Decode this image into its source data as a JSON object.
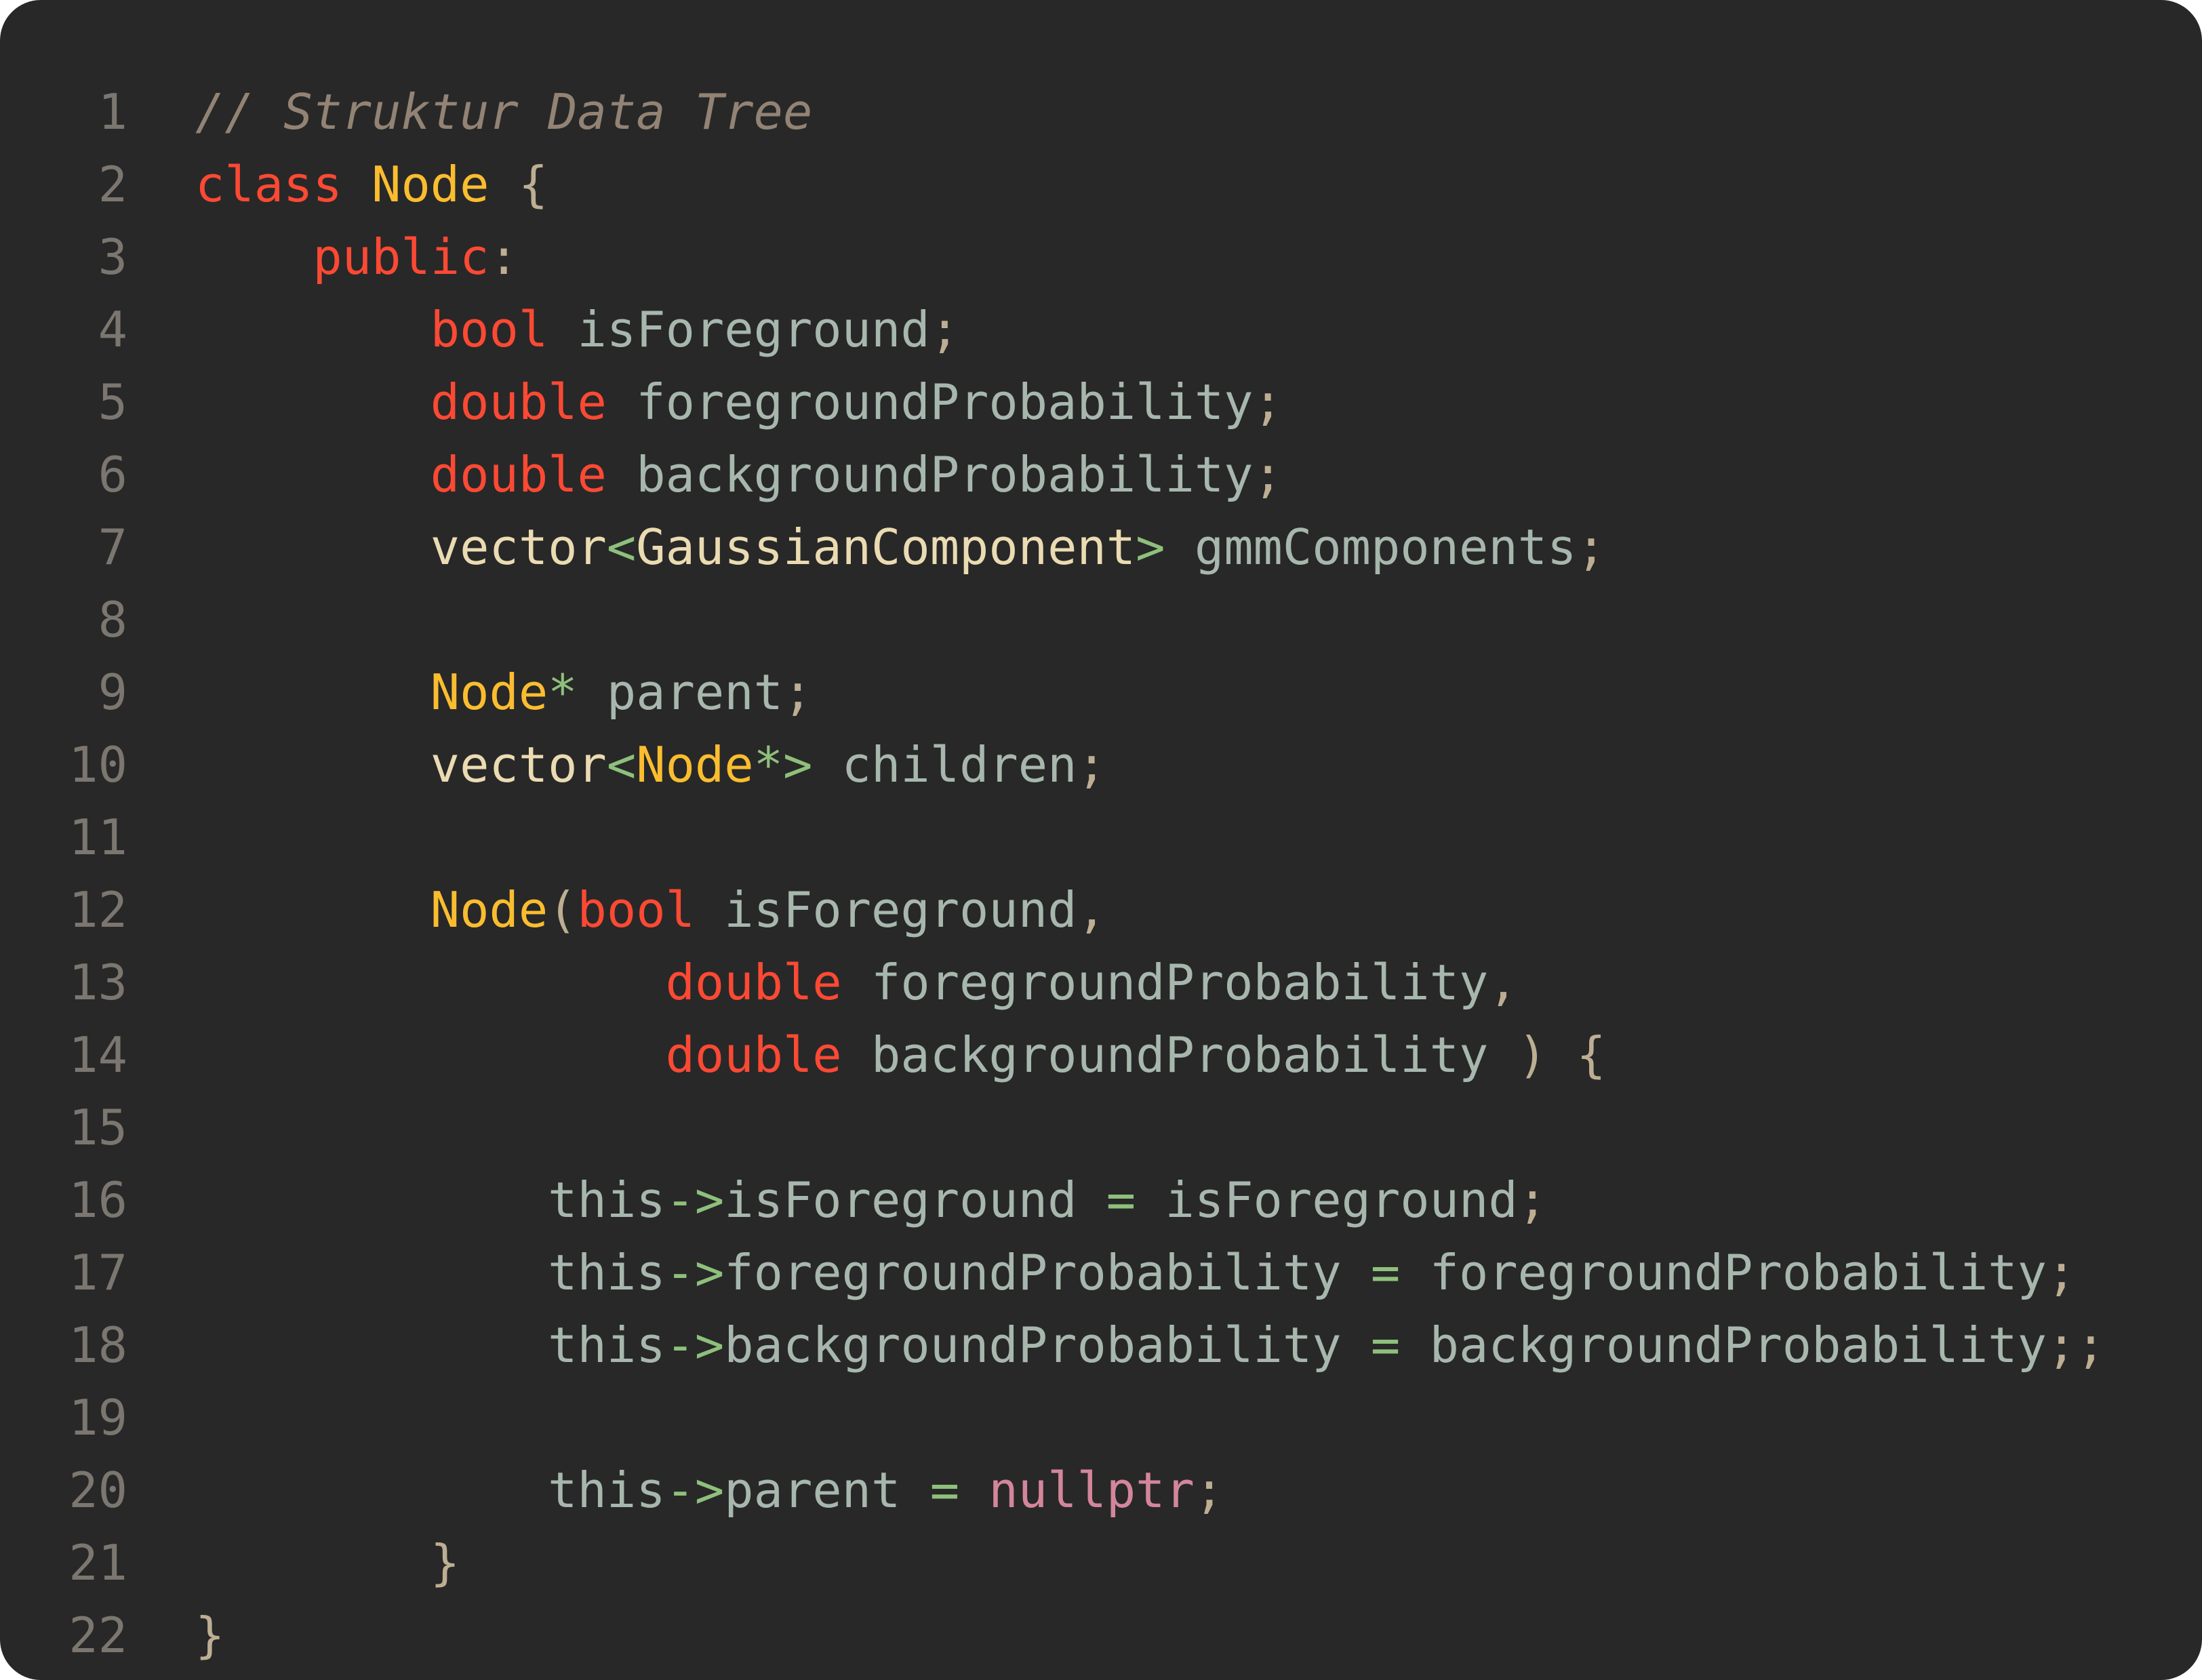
{
  "colors": {
    "background": "#282828",
    "line_number": "#7c7670",
    "comment": "#928374",
    "keyword": "#fb4934",
    "type": "#fabd2f",
    "template": "#ebdbb2",
    "operator": "#8ec07c",
    "punctuation": "#bdae93",
    "identifier": "#a7b7ad",
    "literal": "#d3869b"
  },
  "code": {
    "lines": [
      {
        "number": "1",
        "tokens": [
          {
            "text": "// Struktur Data Tree",
            "kind": "cm"
          }
        ]
      },
      {
        "number": "2",
        "tokens": [
          {
            "text": "class",
            "kind": "kw"
          },
          {
            "text": " ",
            "kind": "id"
          },
          {
            "text": "Node",
            "kind": "ty"
          },
          {
            "text": " {",
            "kind": "pu"
          }
        ]
      },
      {
        "number": "3",
        "tokens": [
          {
            "text": "    ",
            "kind": "id"
          },
          {
            "text": "public",
            "kind": "kw"
          },
          {
            "text": ":",
            "kind": "pu"
          }
        ]
      },
      {
        "number": "4",
        "tokens": [
          {
            "text": "        ",
            "kind": "id"
          },
          {
            "text": "bool",
            "kind": "kw"
          },
          {
            "text": " isForeground",
            "kind": "id"
          },
          {
            "text": ";",
            "kind": "pu"
          }
        ]
      },
      {
        "number": "5",
        "tokens": [
          {
            "text": "        ",
            "kind": "id"
          },
          {
            "text": "double",
            "kind": "kw"
          },
          {
            "text": " foregroundProbability",
            "kind": "id"
          },
          {
            "text": ";",
            "kind": "pu"
          }
        ]
      },
      {
        "number": "6",
        "tokens": [
          {
            "text": "        ",
            "kind": "id"
          },
          {
            "text": "double",
            "kind": "kw"
          },
          {
            "text": " backgroundProbability",
            "kind": "id"
          },
          {
            "text": ";",
            "kind": "pu"
          }
        ]
      },
      {
        "number": "7",
        "tokens": [
          {
            "text": "        ",
            "kind": "id"
          },
          {
            "text": "vector",
            "kind": "vt"
          },
          {
            "text": "<",
            "kind": "op"
          },
          {
            "text": "GaussianComponent",
            "kind": "vt"
          },
          {
            "text": ">",
            "kind": "op"
          },
          {
            "text": " gmmComponents",
            "kind": "id"
          },
          {
            "text": ";",
            "kind": "pu"
          }
        ]
      },
      {
        "number": "8",
        "tokens": []
      },
      {
        "number": "9",
        "tokens": [
          {
            "text": "        ",
            "kind": "id"
          },
          {
            "text": "Node",
            "kind": "ty"
          },
          {
            "text": "*",
            "kind": "op"
          },
          {
            "text": " parent",
            "kind": "id"
          },
          {
            "text": ";",
            "kind": "pu"
          }
        ]
      },
      {
        "number": "10",
        "tokens": [
          {
            "text": "        ",
            "kind": "id"
          },
          {
            "text": "vector",
            "kind": "vt"
          },
          {
            "text": "<",
            "kind": "op"
          },
          {
            "text": "Node",
            "kind": "ty"
          },
          {
            "text": "*>",
            "kind": "op"
          },
          {
            "text": " children",
            "kind": "id"
          },
          {
            "text": ";",
            "kind": "pu"
          }
        ]
      },
      {
        "number": "11",
        "tokens": []
      },
      {
        "number": "12",
        "tokens": [
          {
            "text": "        ",
            "kind": "id"
          },
          {
            "text": "Node",
            "kind": "ty"
          },
          {
            "text": "(",
            "kind": "pu"
          },
          {
            "text": "bool",
            "kind": "kw"
          },
          {
            "text": " isForeground",
            "kind": "id"
          },
          {
            "text": ",",
            "kind": "pu"
          }
        ]
      },
      {
        "number": "13",
        "tokens": [
          {
            "text": "                ",
            "kind": "id"
          },
          {
            "text": "double",
            "kind": "kw"
          },
          {
            "text": " foregroundProbability",
            "kind": "id"
          },
          {
            "text": ",",
            "kind": "pu"
          }
        ]
      },
      {
        "number": "14",
        "tokens": [
          {
            "text": "                ",
            "kind": "id"
          },
          {
            "text": "double",
            "kind": "kw"
          },
          {
            "text": " backgroundProbability",
            "kind": "id"
          },
          {
            "text": " ) {",
            "kind": "pu"
          }
        ]
      },
      {
        "number": "15",
        "tokens": []
      },
      {
        "number": "16",
        "tokens": [
          {
            "text": "            this",
            "kind": "id"
          },
          {
            "text": "->",
            "kind": "op"
          },
          {
            "text": "isForeground ",
            "kind": "id"
          },
          {
            "text": "=",
            "kind": "op"
          },
          {
            "text": " isForeground",
            "kind": "id"
          },
          {
            "text": ";",
            "kind": "pu"
          }
        ]
      },
      {
        "number": "17",
        "tokens": [
          {
            "text": "            this",
            "kind": "id"
          },
          {
            "text": "->",
            "kind": "op"
          },
          {
            "text": "foregroundProbability ",
            "kind": "id"
          },
          {
            "text": "=",
            "kind": "op"
          },
          {
            "text": " foregroundProbability",
            "kind": "id"
          },
          {
            "text": ";",
            "kind": "pu"
          }
        ]
      },
      {
        "number": "18",
        "tokens": [
          {
            "text": "            this",
            "kind": "id"
          },
          {
            "text": "->",
            "kind": "op"
          },
          {
            "text": "backgroundProbability ",
            "kind": "id"
          },
          {
            "text": "=",
            "kind": "op"
          },
          {
            "text": " backgroundProbability",
            "kind": "id"
          },
          {
            "text": ";;",
            "kind": "pu"
          }
        ]
      },
      {
        "number": "19",
        "tokens": []
      },
      {
        "number": "20",
        "tokens": [
          {
            "text": "            this",
            "kind": "id"
          },
          {
            "text": "->",
            "kind": "op"
          },
          {
            "text": "parent ",
            "kind": "id"
          },
          {
            "text": "=",
            "kind": "op"
          },
          {
            "text": " ",
            "kind": "id"
          },
          {
            "text": "nullptr",
            "kind": "nu"
          },
          {
            "text": ";",
            "kind": "pu"
          }
        ]
      },
      {
        "number": "21",
        "tokens": [
          {
            "text": "        }",
            "kind": "pu"
          }
        ]
      },
      {
        "number": "22",
        "tokens": [
          {
            "text": "}",
            "kind": "pu"
          }
        ]
      }
    ]
  }
}
